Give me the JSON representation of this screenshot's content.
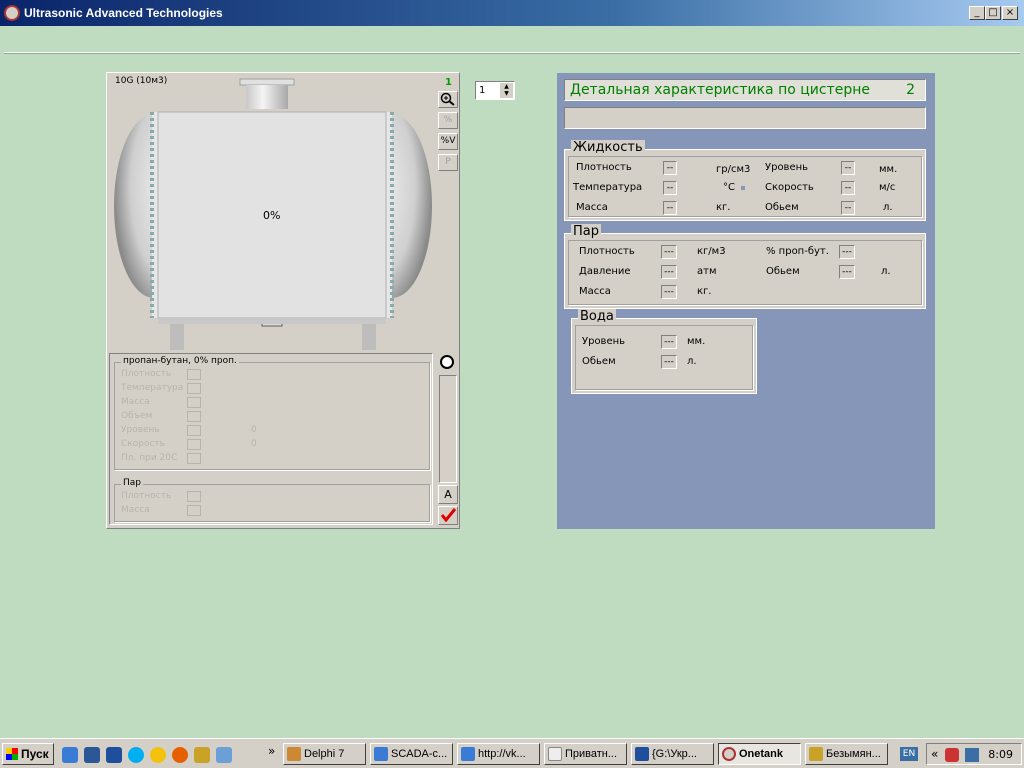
{
  "window": {
    "title": "Ultrasonic Advanced Technologies"
  },
  "tank": {
    "name": "10G (10м3)",
    "fill_percent": "0%",
    "tool_number": "1",
    "tool_pv": "%V",
    "tool_percent": "%",
    "tool_p": "P",
    "spinner_value": "1",
    "liquid_group_title": "пропан-бутан, 0% проп.",
    "liquid_labels": [
      "Плотность",
      "Температура",
      "Масса",
      "Объем",
      "Уровень",
      "Скорость",
      "Пл. при 20С"
    ],
    "liquid_values": [
      "0",
      "0"
    ],
    "vapor_group_title": "Пар",
    "vapor_labels": [
      "Плотность",
      "Масса"
    ],
    "btn_a": "A"
  },
  "detail": {
    "title": "Детальная характеристика по цистерне",
    "number": "2",
    "liquid": {
      "title": "Жидкость",
      "rows": [
        {
          "label": "Плотность",
          "value": "--",
          "unit": "гр/см3",
          "label2": "Уровень",
          "value2": "--",
          "unit2": "мм."
        },
        {
          "label": "Температура",
          "value": "--",
          "unit": "°С",
          "label2": "Скорость",
          "value2": "--",
          "unit2": "м/с"
        },
        {
          "label": "Масса",
          "value": "--",
          "unit": "кг.",
          "label2": "Обьем",
          "value2": "--",
          "unit2": "л."
        }
      ]
    },
    "vapor": {
      "title": "Пар",
      "rows": [
        {
          "label": "Плотность",
          "value": "---",
          "unit": "кг/м3",
          "label2": "% проп-бут.",
          "value2": "---",
          "unit2": ""
        },
        {
          "label": "Давление",
          "value": "---",
          "unit": "атм",
          "label2": "Обьем",
          "value2": "---",
          "unit2": "л."
        },
        {
          "label": "Масса",
          "value": "---",
          "unit": "кг.",
          "label2": "",
          "value2": "",
          "unit2": ""
        }
      ]
    },
    "water": {
      "title": "Вода",
      "rows": [
        {
          "label": "Уровень",
          "value": "---",
          "unit": "мм."
        },
        {
          "label": "Обьем",
          "value": "---",
          "unit": "л."
        }
      ]
    }
  },
  "taskbar": {
    "start": "Пуск",
    "chevron": "»",
    "tasks": [
      "Delphi 7",
      "SCADA-с...",
      "http://vk...",
      "Приватн...",
      "{G:\\Укр...",
      "Onetank",
      "Безымян..."
    ],
    "lang": "EN",
    "tray_chevron": "«",
    "clock": "8:09"
  }
}
